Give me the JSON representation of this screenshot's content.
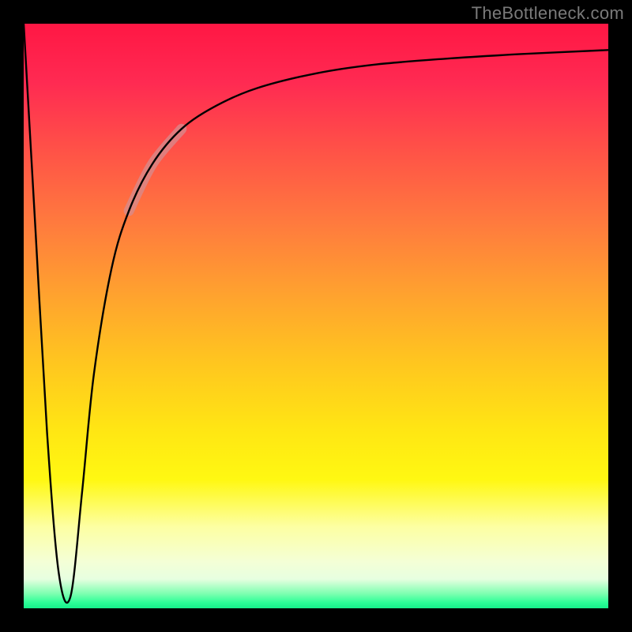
{
  "attribution": "TheBottleneck.com",
  "chart_data": {
    "type": "line",
    "title": "",
    "xlabel": "",
    "ylabel": "",
    "xlim": [
      0,
      100
    ],
    "ylim": [
      0,
      100
    ],
    "grid": false,
    "series": [
      {
        "name": "curve",
        "x": [
          0,
          2,
          4,
          6,
          8,
          10,
          12,
          15,
          18,
          22,
          27,
          33,
          40,
          50,
          60,
          72,
          85,
          100
        ],
        "y": [
          100,
          65,
          30,
          6,
          2,
          20,
          40,
          58,
          68,
          76,
          82,
          86,
          89,
          91.5,
          93,
          94,
          94.8,
          95.5
        ]
      }
    ],
    "highlight": {
      "series": "curve",
      "x_range": [
        19,
        27
      ],
      "y_range": [
        70,
        82
      ],
      "note": "softened pinkish segment overlay on curve"
    },
    "background_gradient": {
      "orientation": "vertical",
      "stops": [
        {
          "pos": 0.0,
          "color": "#ff1744"
        },
        {
          "pos": 0.22,
          "color": "#ff5347"
        },
        {
          "pos": 0.46,
          "color": "#ffa12f"
        },
        {
          "pos": 0.7,
          "color": "#ffe713"
        },
        {
          "pos": 0.92,
          "color": "#f4ffd6"
        },
        {
          "pos": 1.0,
          "color": "#16f08a"
        }
      ]
    }
  }
}
